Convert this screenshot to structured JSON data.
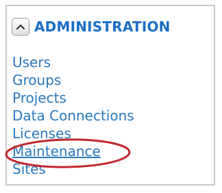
{
  "section": {
    "title": "ADMINISTRATION",
    "collapse_icon": "chevron-up-icon",
    "collapsed": false
  },
  "nav": {
    "items": [
      {
        "id": "users",
        "label": "Users"
      },
      {
        "id": "groups",
        "label": "Groups"
      },
      {
        "id": "projects",
        "label": "Projects"
      },
      {
        "id": "data-connections",
        "label": "Data Connections"
      },
      {
        "id": "licenses",
        "label": "Licenses"
      },
      {
        "id": "maintenance",
        "label": "Maintenance",
        "highlighted": true
      },
      {
        "id": "sites",
        "label": "Sites"
      }
    ]
  },
  "colors": {
    "title": "#1a6fc4",
    "link": "#2a78bc",
    "panel_border": "#c8c8c8",
    "highlight_oval": "#c0262c"
  }
}
